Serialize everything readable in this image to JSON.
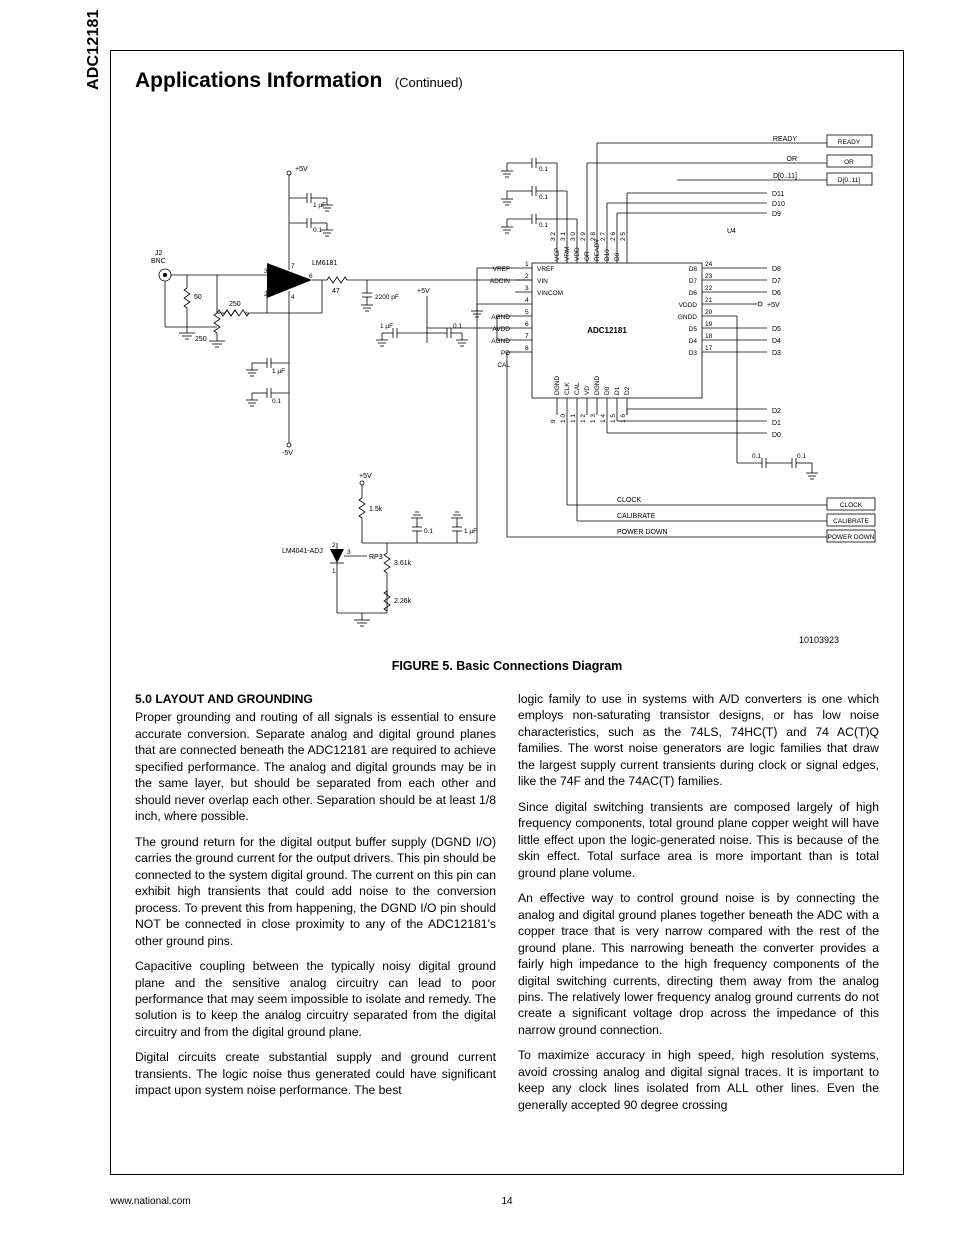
{
  "part_number": "ADC12181",
  "section": {
    "title": "Applications Information",
    "continued": "(Continued)"
  },
  "figure": {
    "caption": "FIGURE 5. Basic Connections Diagram",
    "id": "10103923",
    "labels": {
      "j2": "J2",
      "bnc": "BNC",
      "r50": "50",
      "r250a": "250",
      "r250b": "250",
      "r47": "47",
      "c2200": "2200 pF",
      "c1uf": "1 µF",
      "c01": "0.1",
      "opamp": "LM6181",
      "p5v": "+5V",
      "m5v": "-5V",
      "vref_block": "LM4041-ADJ",
      "rp3": "RP3",
      "r15k": "1.5k",
      "r361k": "3.61k",
      "r226k": "2.26k",
      "adc": "ADC12181",
      "u4": "U4",
      "left_pins": [
        "VREF",
        "ADCIN",
        "",
        "",
        "AGND",
        "AVDD",
        "AGND",
        "PD",
        "CAL"
      ],
      "left_inner": [
        "VREF",
        "VIN",
        "VINCOM"
      ],
      "left_nums": [
        "1",
        "2",
        "3",
        "4",
        "5",
        "6",
        "7",
        "8"
      ],
      "bottom_pins": [
        "DGND",
        "CLK",
        "CAL",
        "VD",
        "DGND",
        "D0",
        "D1",
        "D2"
      ],
      "bottom_inner_nums": [
        "9",
        "1 0",
        "1 1",
        "1 2",
        "1 3",
        "1 4",
        "1 5",
        "1 6"
      ],
      "right_pins": [
        "D8",
        "D7",
        "D6",
        "VDDD",
        "GNDD",
        "D5",
        "D4",
        "D3"
      ],
      "right_nums": [
        "24",
        "23",
        "22",
        "21",
        "20",
        "19",
        "18",
        "17"
      ],
      "top_pins": [
        "VCP",
        "VRM",
        "VDD",
        "OR",
        "READY",
        "D10",
        "D9"
      ],
      "top_nums": [
        "3 2",
        "3 1",
        "3 0",
        "2 9",
        "2 8",
        "2 7",
        "2 6",
        "2 5"
      ],
      "top_out": [
        "READY",
        "OR",
        "D[0..11]"
      ],
      "top_right": [
        "D11",
        "D10",
        "D9"
      ],
      "right_out": [
        "D8",
        "D7",
        "D6",
        "",
        "D5",
        "D4",
        "D3",
        "D2",
        "D1",
        "D0"
      ],
      "bus_sig": [
        "CLOCK",
        "CALIBRATE",
        "POWER DOWN"
      ],
      "bus_out": [
        "CLOCK",
        "CALIBRATE",
        "POWER DOWN"
      ]
    }
  },
  "body": {
    "subhead": "5.0 LAYOUT AND GROUNDING",
    "p1": "Proper grounding and routing of all signals is essential to ensure accurate conversion. Separate analog and digital ground planes that are connected beneath the ADC12181 are required to achieve specified performance. The analog and digital grounds may be in the same layer, but should be separated from each other and should never overlap each other. Separation should be at least 1/8 inch, where possible.",
    "p2": "The ground return for the digital output buffer supply (DGND I/O) carries the ground current for the output drivers. This pin should be connected to the system digital ground. The current on this pin can exhibit high transients that could add noise to the conversion process. To prevent this from happening, the DGND I/O pin should NOT be connected in close proximity to any of the ADC12181's other ground pins.",
    "p3": "Capacitive coupling between the typically noisy digital ground plane and the sensitive analog circuitry can lead to poor performance that may seem impossible to isolate and remedy. The solution is to keep the analog circuitry separated from the digital circuitry and from the digital ground plane.",
    "p4": "Digital circuits create substantial supply and ground current transients. The logic noise thus generated could have significant impact upon system noise performance. The best",
    "p5": "logic family to use in systems with A/D converters is one which employs non-saturating transistor designs, or has low noise characteristics, such as the 74LS, 74HC(T) and 74 AC(T)Q families. The worst noise generators are logic families that draw the largest supply current transients during clock or signal edges, like the 74F and the 74AC(T) families.",
    "p6": "Since digital switching transients are composed largely of high frequency components, total ground plane copper weight will have little effect upon the logic-generated noise. This is because of the skin effect. Total surface area is more important than is total ground plane volume.",
    "p7": "An effective way to control ground noise is by connecting the analog and digital ground planes together beneath the ADC with a copper trace that is very narrow compared with the rest of the ground plane. This narrowing beneath the converter provides a fairly high impedance to the high frequency components of the digital switching currents, directing them away from the analog pins. The relatively lower frequency analog ground currents do not create a significant voltage drop across the impedance of this narrow ground connection.",
    "p8": "To maximize accuracy in high speed, high resolution systems, avoid crossing analog and digital signal traces. It is important to keep any clock lines isolated from ALL other lines. Even the generally accepted 90 degree crossing"
  },
  "footer": {
    "url": "www.national.com",
    "page": "14"
  }
}
